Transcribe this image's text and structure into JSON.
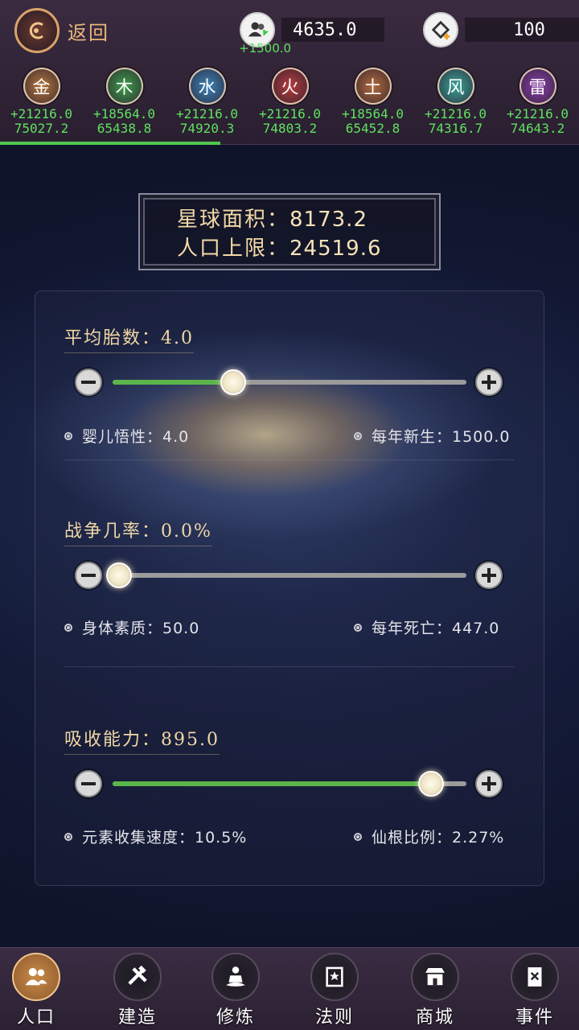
{
  "header": {
    "back_label": "返回",
    "population": "4635.0",
    "population_delta": "+1500.0",
    "currency": "100"
  },
  "elements": [
    {
      "name": "金",
      "rate": "+21216.0",
      "value": "75027.2",
      "color": "#b5763c"
    },
    {
      "name": "木",
      "rate": "+18564.0",
      "value": "65438.8",
      "color": "#3f9c4a"
    },
    {
      "name": "水",
      "rate": "+21216.0",
      "value": "74920.3",
      "color": "#3c84b8"
    },
    {
      "name": "火",
      "rate": "+21216.0",
      "value": "74803.2",
      "color": "#b63c3c"
    },
    {
      "name": "土",
      "rate": "+18564.0",
      "value": "65452.8",
      "color": "#b26a3a"
    },
    {
      "name": "风",
      "rate": "+21216.0",
      "value": "74316.7",
      "color": "#3aa59a"
    },
    {
      "name": "雷",
      "rate": "+21216.0",
      "value": "74643.2",
      "color": "#8a3fa8"
    }
  ],
  "planet": {
    "area_label": "星球面积：",
    "area_value": "8173.2",
    "limit_label": "人口上限：",
    "limit_value": "24519.6"
  },
  "sections": [
    {
      "title": "平均胎数：4.0",
      "slider_fraction": 0.34,
      "stat_left": "婴儿悟性：4.0",
      "stat_right": "每年新生：1500.0"
    },
    {
      "title": "战争几率：0.0%",
      "slider_fraction": 0.0,
      "stat_left": "身体素质：50.0",
      "stat_right": "每年死亡：447.0"
    },
    {
      "title": "吸收能力：895.0",
      "slider_fraction": 0.9,
      "stat_left": "元素收集速度：10.5%",
      "stat_right": "仙根比例：2.27%"
    }
  ],
  "nav": [
    {
      "label": "人口",
      "icon": "people-icon",
      "active": true
    },
    {
      "label": "建造",
      "icon": "tools-icon",
      "active": false
    },
    {
      "label": "修炼",
      "icon": "meditate-icon",
      "active": false
    },
    {
      "label": "法则",
      "icon": "law-book-icon",
      "active": false
    },
    {
      "label": "商城",
      "icon": "shop-icon",
      "active": false
    },
    {
      "label": "事件",
      "icon": "event-book-icon",
      "active": false
    }
  ]
}
